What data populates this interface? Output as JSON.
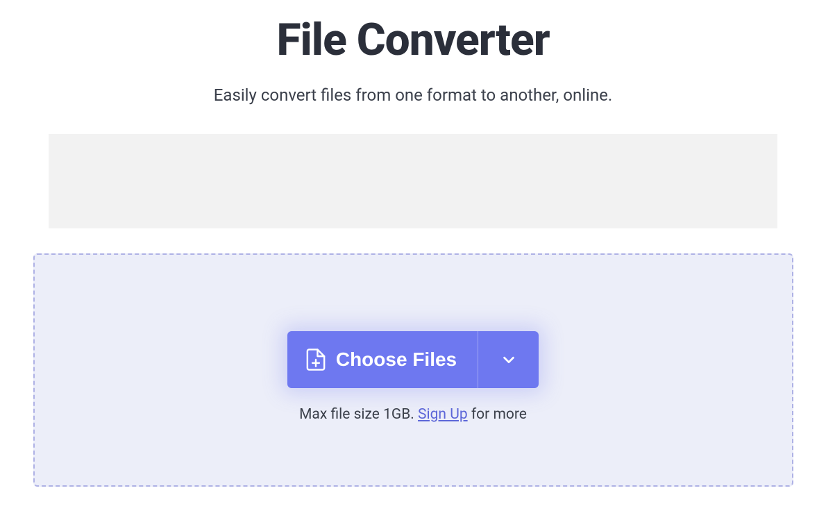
{
  "header": {
    "title": "File Converter",
    "subtitle": "Easily convert files from one format to another, online."
  },
  "dropzone": {
    "button_label": "Choose Files",
    "caption_prefix": "Max file size 1GB. ",
    "signup_label": "Sign Up",
    "caption_suffix": " for more"
  },
  "colors": {
    "accent": "#6e78f0",
    "text_dark": "#2b2f3a",
    "dropzone_bg": "#eceef9",
    "dropzone_border": "#aeb1e5"
  }
}
